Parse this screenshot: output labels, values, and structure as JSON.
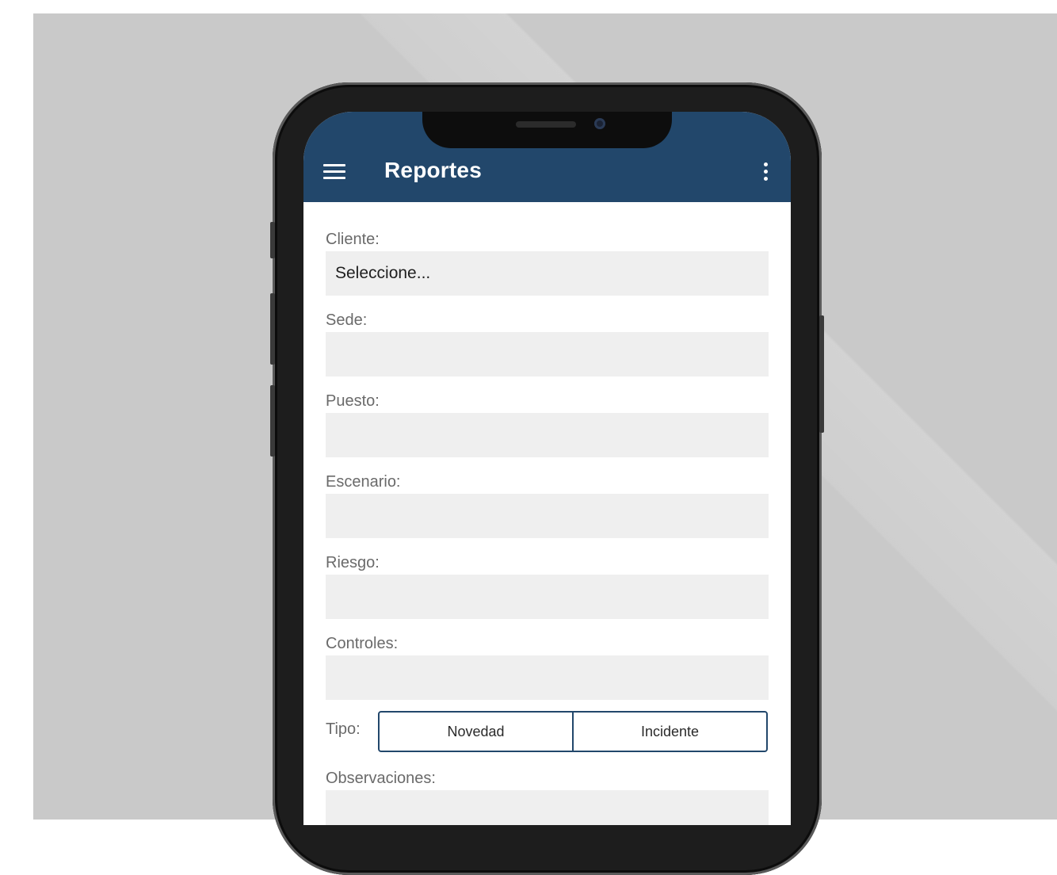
{
  "app": {
    "title": "Reportes"
  },
  "colors": {
    "app_bar": "#22476b",
    "field_background": "#efefef",
    "backdrop": "#c9c9c9"
  },
  "icons": {
    "menu": "hamburger-menu-icon",
    "more": "more-vertical-icon"
  },
  "form": {
    "cliente": {
      "label": "Cliente:",
      "value": "Seleccione..."
    },
    "sede": {
      "label": "Sede:",
      "value": ""
    },
    "puesto": {
      "label": "Puesto:",
      "value": ""
    },
    "escenario": {
      "label": "Escenario:",
      "value": ""
    },
    "riesgo": {
      "label": "Riesgo:",
      "value": ""
    },
    "controles": {
      "label": "Controles:",
      "value": ""
    },
    "tipo": {
      "label": "Tipo:",
      "options": [
        "Novedad",
        "Incidente"
      ]
    },
    "observaciones": {
      "label": "Observaciones:",
      "value": ""
    }
  }
}
